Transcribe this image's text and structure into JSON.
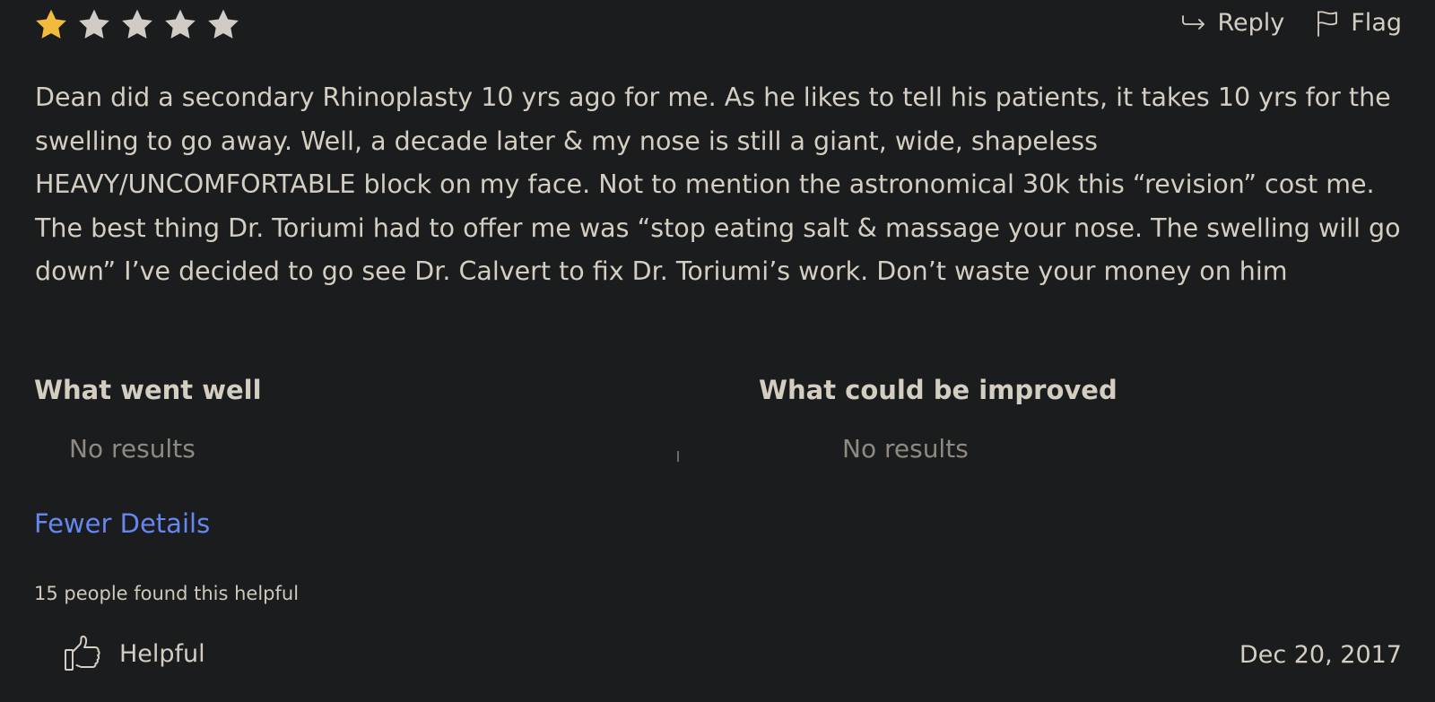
{
  "rating": {
    "value": 1,
    "max": 5,
    "filled_color": "#f2bb3c",
    "empty_color": "#d0ccc5"
  },
  "actions": {
    "reply_label": "Reply",
    "reply_icon": "reply-arrow-icon",
    "flag_label": "Flag",
    "flag_icon": "flag-icon"
  },
  "review": {
    "text": "Dean did a secondary Rhinoplasty 10 yrs ago for me. As he likes to tell his patients, it takes 10 yrs for the swelling to go away. Well, a decade later & my nose is still a giant, wide, shapeless HEAVY/UNCOMFORTABLE block on my face. Not to mention the astronomical 30k this “revision” cost me. The best thing Dr. Toriumi had to offer me was “stop eating salt & massage your nose. The swelling will go down” I’ve decided to go see Dr. Calvert to fix Dr. Toriumi’s work. Don’t waste your money on him"
  },
  "details": {
    "went_well": {
      "title": "What went well",
      "empty_text": "No results"
    },
    "improved": {
      "title": "What could be improved",
      "empty_text": "No results"
    },
    "toggle_label": "Fewer Details",
    "link_color": "#6686f0"
  },
  "footer": {
    "helpful_count_text": "15 people found this helpful",
    "helpful_label": "Helpful",
    "helpful_icon": "thumbs-up-icon",
    "date": "Dec 20, 2017"
  }
}
